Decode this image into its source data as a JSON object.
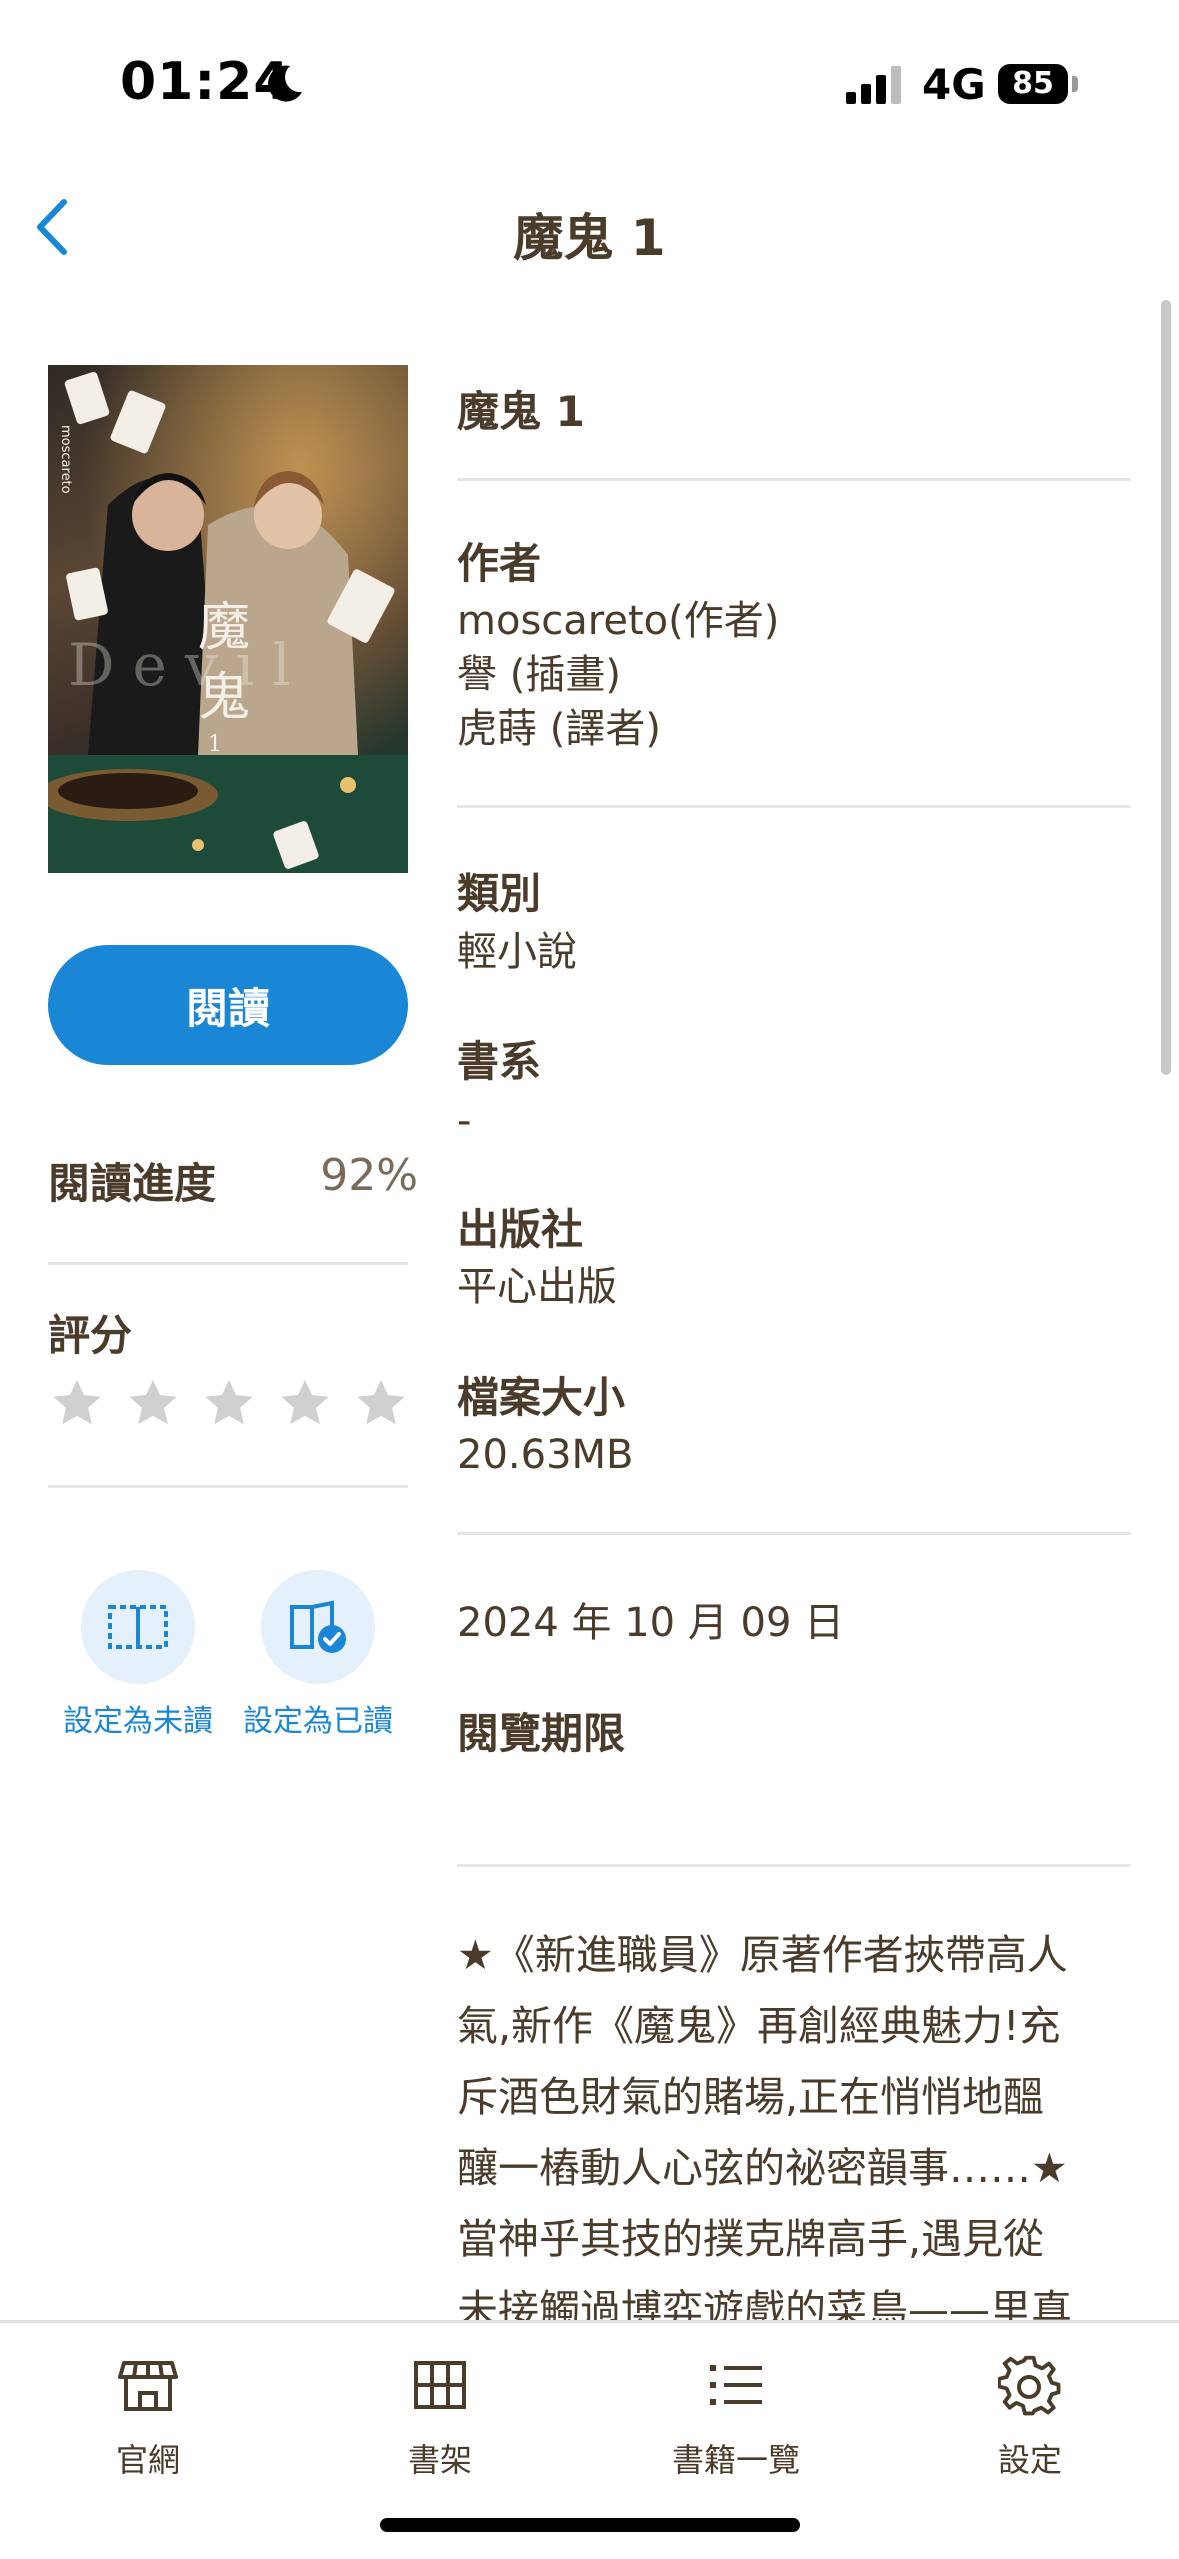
{
  "status_bar": {
    "time": "01:24",
    "network": "4G",
    "battery": "85"
  },
  "header": {
    "title": "魔鬼 1"
  },
  "cover": {
    "title_glyphs": [
      "魔",
      "鬼"
    ],
    "volume": "1",
    "subtitle": "Devil",
    "author_mark": "moscareto"
  },
  "actions": {
    "read_label": "閱讀",
    "progress_label": "閱讀進度",
    "progress_value": "92%",
    "progress_fraction": 0.92,
    "rating_label": "評分",
    "rating_stars": 0,
    "rating_max": 5,
    "mark_unread_label": "設定為未讀",
    "mark_read_label": "設定為已讀"
  },
  "details": {
    "book_title": "魔鬼 1",
    "author_heading": "作者",
    "authors": [
      "moscareto(作者)",
      "譽 (插畫)",
      "虎蒔 (譯者)"
    ],
    "category_heading": "類別",
    "category": "輕小說",
    "series_heading": "書系",
    "series": "-",
    "publisher_heading": "出版社",
    "publisher": "平心出版",
    "filesize_heading": "檔案大小",
    "filesize": "20.63MB",
    "date": "2024 年 10 月 09 日",
    "period_heading": "閱覽期限"
  },
  "description": {
    "lines": [
      "★《新進職員》原著作者挾帶高人",
      "氣,新作《魔鬼》再創經典魅力!充",
      "斥酒色財氣的賭場,正在悄悄地醞",
      "釀一樁動人心弦的祕密韻事……★",
      "當神乎其技的撲克牌高手,遇見從",
      "未接觸過博弈遊戲的菜鳥——里真"
    ]
  },
  "tabs": [
    {
      "label": "官網",
      "icon": "store-icon"
    },
    {
      "label": "書架",
      "icon": "bookshelf-icon"
    },
    {
      "label": "書籍一覽",
      "icon": "list-icon"
    },
    {
      "label": "設定",
      "icon": "gear-icon"
    }
  ],
  "colors": {
    "accent": "#1a86d6",
    "text": "#4a3b2a",
    "star_empty": "#d0d0d0"
  }
}
